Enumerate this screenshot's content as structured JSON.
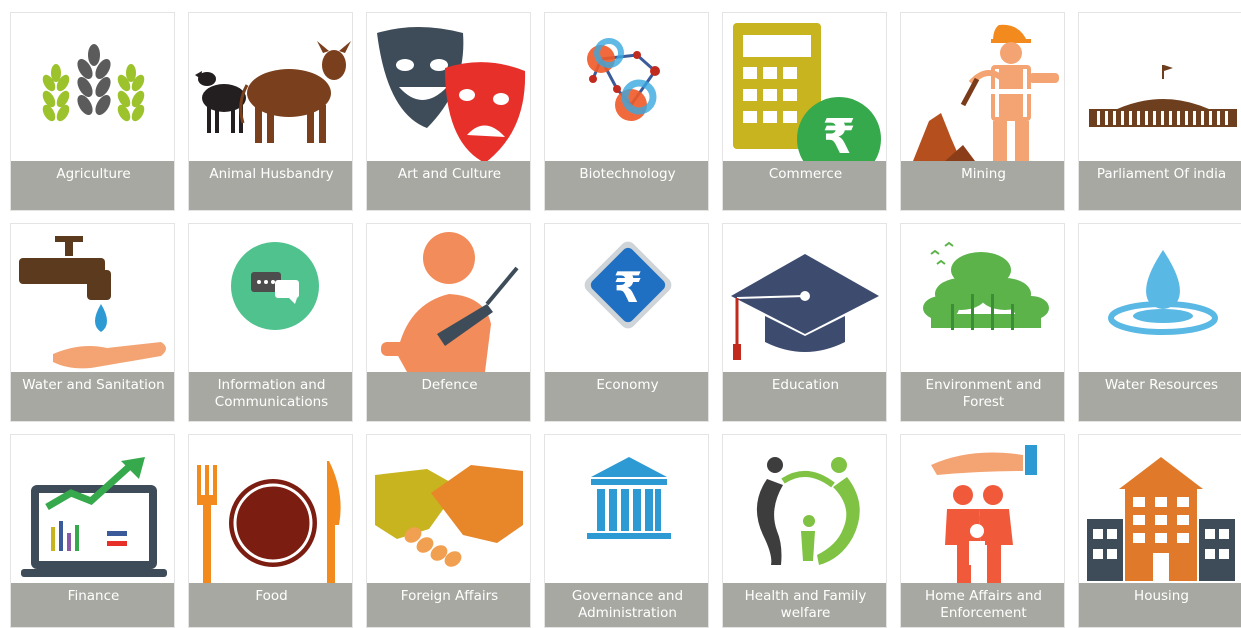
{
  "categories": [
    {
      "label": "Agriculture",
      "icon": "wheat-icon"
    },
    {
      "label": "Animal Husbandry",
      "icon": "cattle-icon"
    },
    {
      "label": "Art and Culture",
      "icon": "theatre-masks-icon"
    },
    {
      "label": "Biotechnology",
      "icon": "molecule-icon"
    },
    {
      "label": "Commerce",
      "icon": "calculator-rupee-icon"
    },
    {
      "label": "Mining",
      "icon": "miner-icon"
    },
    {
      "label": "Parliament Of india",
      "icon": "parliament-building-icon"
    },
    {
      "label": "Water and Sanitation",
      "icon": "water-tap-icon"
    },
    {
      "label": "Information and Communications",
      "icon": "chat-bubble-icon"
    },
    {
      "label": "Defence",
      "icon": "soldier-rifle-icon"
    },
    {
      "label": "Economy",
      "icon": "rupee-diamond-icon"
    },
    {
      "label": "Education",
      "icon": "graduation-cap-icon"
    },
    {
      "label": "Environment and Forest",
      "icon": "forest-icon"
    },
    {
      "label": "Water Resources",
      "icon": "water-drop-icon"
    },
    {
      "label": "Finance",
      "icon": "finance-laptop-icon"
    },
    {
      "label": "Food",
      "icon": "fork-plate-knife-icon"
    },
    {
      "label": "Foreign Affairs",
      "icon": "handshake-icon"
    },
    {
      "label": "Governance and Administration",
      "icon": "government-building-icon"
    },
    {
      "label": "Health and Family welfare",
      "icon": "family-health-icon"
    },
    {
      "label": "Home Affairs and Enforcement",
      "icon": "protected-family-icon"
    },
    {
      "label": "Housing",
      "icon": "apartment-building-icon"
    }
  ]
}
